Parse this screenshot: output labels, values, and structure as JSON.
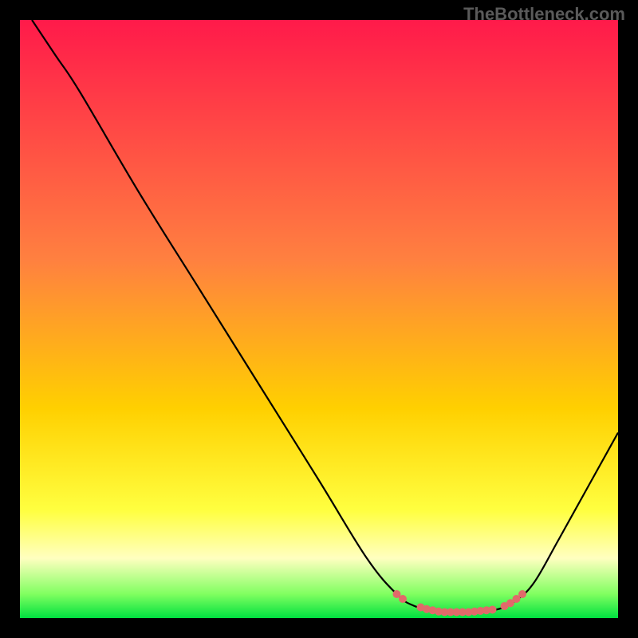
{
  "watermark": "TheBottleneck.com",
  "chart_data": {
    "type": "line",
    "title": "",
    "xlabel": "",
    "ylabel": "",
    "xlim": [
      0,
      100
    ],
    "ylim": [
      0,
      100
    ],
    "gradient_stops": [
      {
        "offset": 0,
        "color": "#ff1a4a"
      },
      {
        "offset": 40,
        "color": "#ff8040"
      },
      {
        "offset": 65,
        "color": "#ffd000"
      },
      {
        "offset": 82,
        "color": "#ffff40"
      },
      {
        "offset": 90,
        "color": "#ffffc0"
      },
      {
        "offset": 96,
        "color": "#80ff60"
      },
      {
        "offset": 100,
        "color": "#00e040"
      }
    ],
    "curve": [
      {
        "x": 2,
        "y": 100
      },
      {
        "x": 6,
        "y": 94
      },
      {
        "x": 10,
        "y": 88
      },
      {
        "x": 20,
        "y": 71
      },
      {
        "x": 30,
        "y": 55
      },
      {
        "x": 40,
        "y": 39
      },
      {
        "x": 50,
        "y": 23
      },
      {
        "x": 58,
        "y": 10
      },
      {
        "x": 63,
        "y": 4
      },
      {
        "x": 66,
        "y": 2
      },
      {
        "x": 70,
        "y": 1
      },
      {
        "x": 75,
        "y": 1
      },
      {
        "x": 80,
        "y": 1.5
      },
      {
        "x": 83,
        "y": 3
      },
      {
        "x": 86,
        "y": 6
      },
      {
        "x": 90,
        "y": 13
      },
      {
        "x": 95,
        "y": 22
      },
      {
        "x": 100,
        "y": 31
      }
    ],
    "dots": [
      {
        "x": 63,
        "y": 4
      },
      {
        "x": 64,
        "y": 3.2
      },
      {
        "x": 67,
        "y": 1.8
      },
      {
        "x": 68,
        "y": 1.5
      },
      {
        "x": 69,
        "y": 1.3
      },
      {
        "x": 70,
        "y": 1.1
      },
      {
        "x": 71,
        "y": 1.0
      },
      {
        "x": 72,
        "y": 1.0
      },
      {
        "x": 73,
        "y": 1.0
      },
      {
        "x": 74,
        "y": 1.0
      },
      {
        "x": 75,
        "y": 1.0
      },
      {
        "x": 76,
        "y": 1.1
      },
      {
        "x": 77,
        "y": 1.2
      },
      {
        "x": 78,
        "y": 1.3
      },
      {
        "x": 79,
        "y": 1.4
      },
      {
        "x": 81,
        "y": 2.0
      },
      {
        "x": 82,
        "y": 2.5
      },
      {
        "x": 83,
        "y": 3.2
      },
      {
        "x": 84,
        "y": 4.0
      }
    ],
    "dot_color": "#e16a6a",
    "curve_color": "#000000"
  }
}
